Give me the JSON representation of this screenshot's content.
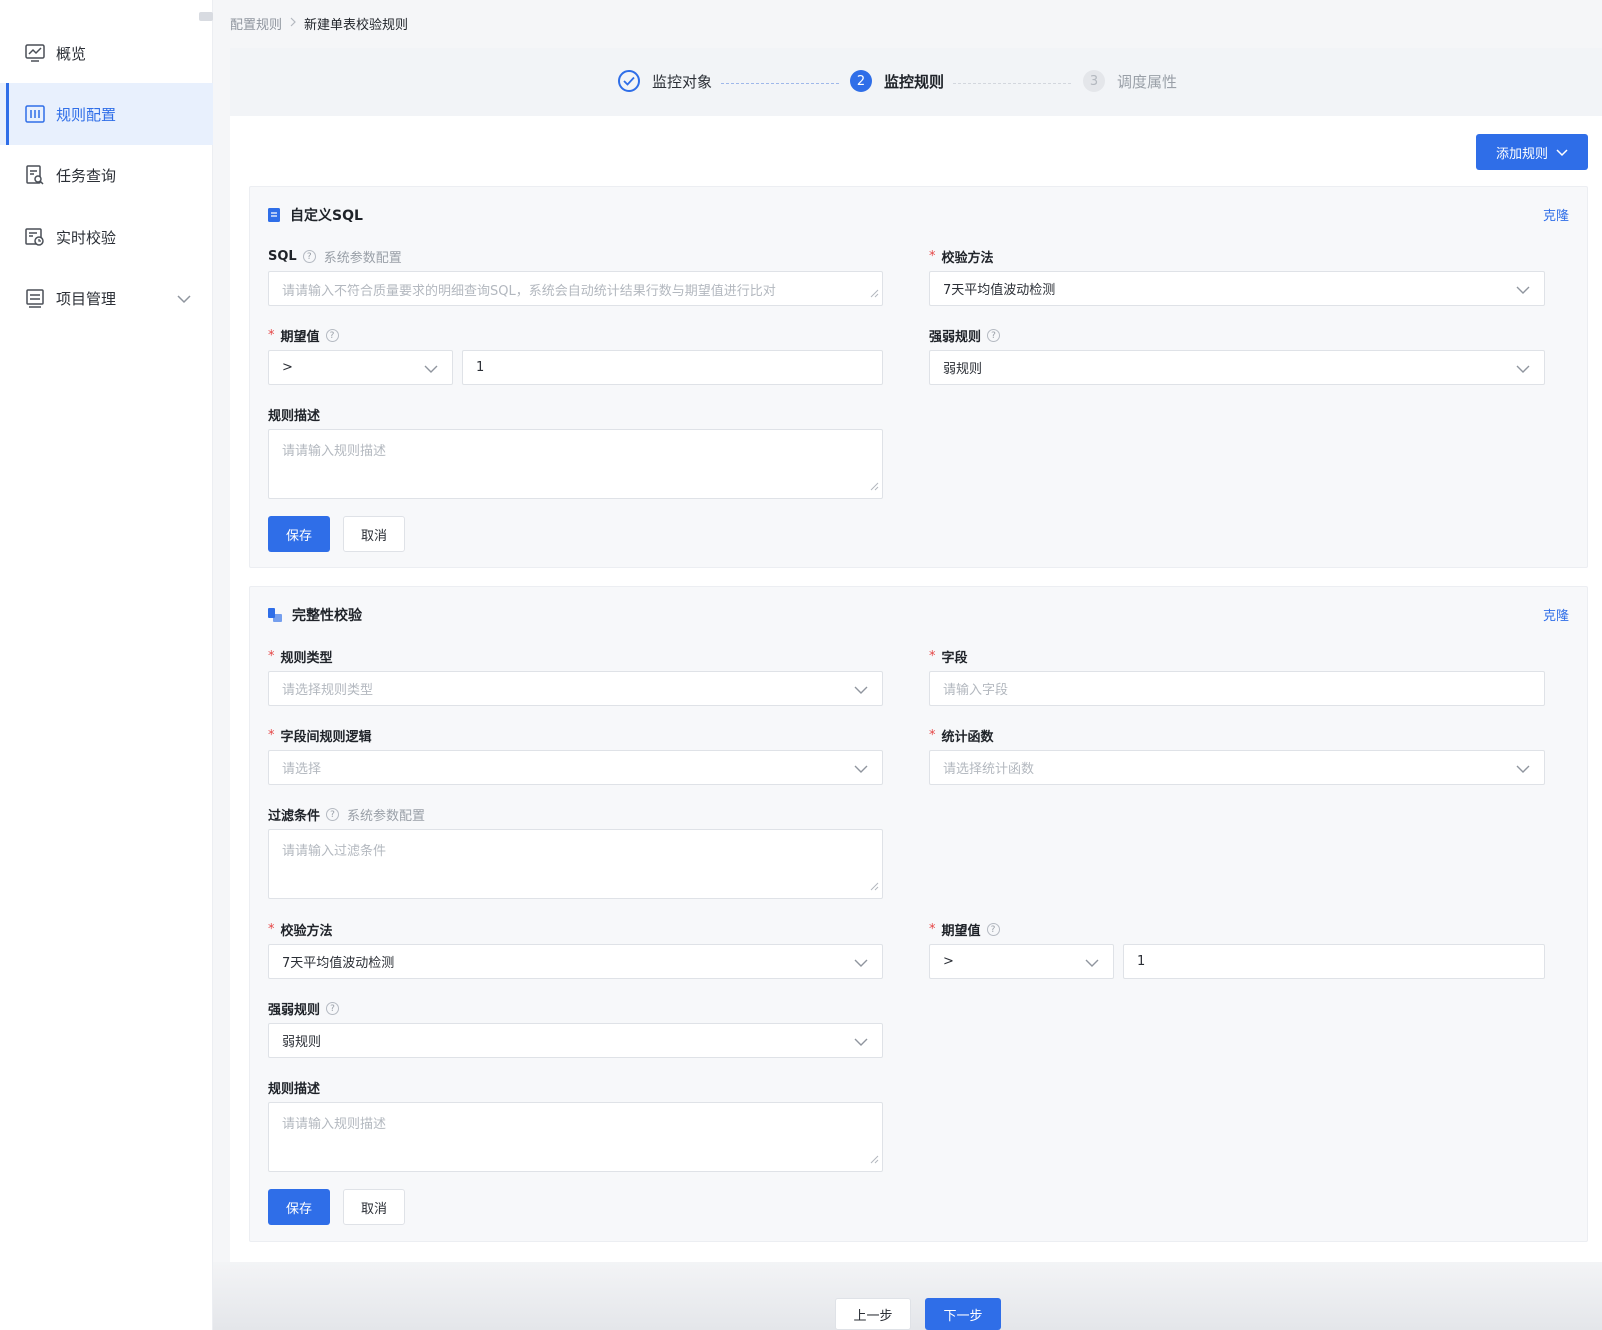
{
  "sidebar": {
    "items": [
      {
        "label": "概览"
      },
      {
        "label": "规则配置"
      },
      {
        "label": "任务查询"
      },
      {
        "label": "实时校验"
      },
      {
        "label": "项目管理"
      }
    ]
  },
  "breadcrumb": {
    "parent": "配置规则",
    "current": "新建单表校验规则"
  },
  "steps": [
    {
      "label": "监控对象",
      "number": ""
    },
    {
      "label": "监控规则",
      "number": "2"
    },
    {
      "label": "调度属性",
      "number": "3"
    }
  ],
  "toolbar": {
    "add_rule_label": "添加规则"
  },
  "card_sql": {
    "title": "自定义SQL",
    "clone_label": "克隆",
    "sql_label": "SQL",
    "sql_sub": "系统参数配置",
    "sql_placeholder": "请请输入不符合质量要求的明细查询SQL，系统会自动统计结果行数与期望值进行比对",
    "method_label": "校验方法",
    "method_value": "7天平均值波动检测",
    "expect_label": "期望值",
    "expect_operator": ">",
    "expect_value": "1",
    "strength_label": "强弱规则",
    "strength_value": "弱规则",
    "desc_label": "规则描述",
    "desc_placeholder": "请请输入规则描述",
    "save_label": "保存",
    "cancel_label": "取消"
  },
  "card_integrity": {
    "title": "完整性校验",
    "clone_label": "克隆",
    "type_label": "规则类型",
    "type_placeholder": "请选择规则类型",
    "field_label": "字段",
    "field_placeholder": "请输入字段",
    "logic_label": "字段间规则逻辑",
    "logic_placeholder": "请选择",
    "stat_label": "统计函数",
    "stat_placeholder": "请选择统计函数",
    "filter_label": "过滤条件",
    "filter_sub": "系统参数配置",
    "filter_placeholder": "请请输入过滤条件",
    "method_label": "校验方法",
    "method_value": "7天平均值波动检测",
    "expect_label": "期望值",
    "expect_operator": ">",
    "expect_value": "1",
    "strength_label": "强弱规则",
    "strength_value": "弱规则",
    "desc_label": "规则描述",
    "desc_placeholder": "请请输入规则描述",
    "save_label": "保存",
    "cancel_label": "取消"
  },
  "footer": {
    "prev_label": "上一步",
    "next_label": "下一步"
  },
  "colors": {
    "accent": "#2f6ee8",
    "required": "#e54545"
  }
}
